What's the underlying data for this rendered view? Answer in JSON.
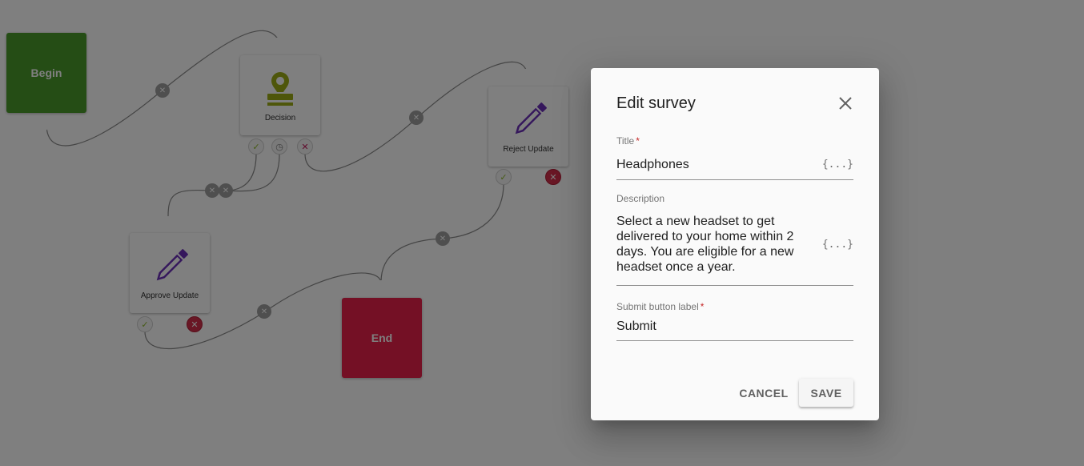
{
  "workflow": {
    "nodes": {
      "begin": {
        "label": "Begin",
        "color": "#4a9a2a"
      },
      "decision": {
        "label": "Decision",
        "icon": "stamp-icon",
        "icon_color": "#9cad14"
      },
      "reject": {
        "label": "Reject Update",
        "icon": "pencil-icon",
        "icon_color": "#6b2fb8"
      },
      "approve": {
        "label": "Approve Update",
        "icon": "pencil-icon",
        "icon_color": "#6b2fb8"
      },
      "end": {
        "label": "End",
        "color": "#e9204a"
      }
    },
    "port_glyphs": {
      "ok": "✓",
      "clock": "◷",
      "fail": "✕",
      "remove": "✕"
    }
  },
  "dialog": {
    "title": "Edit survey",
    "fields": {
      "title": {
        "label": "Title",
        "required_mark": "*",
        "value": "Headphones",
        "expr": "{...}"
      },
      "description": {
        "label": "Description",
        "lines": [
          "Select a new headset to get",
          "delivered to your home within 2",
          "days. You are eligible for a new",
          "headset once a year."
        ],
        "expr": "{...}"
      },
      "submit_label": {
        "label": "Submit button label",
        "required_mark": "*",
        "value": "Submit"
      }
    },
    "cancel_label": "CANCEL",
    "save_label": "SAVE"
  }
}
